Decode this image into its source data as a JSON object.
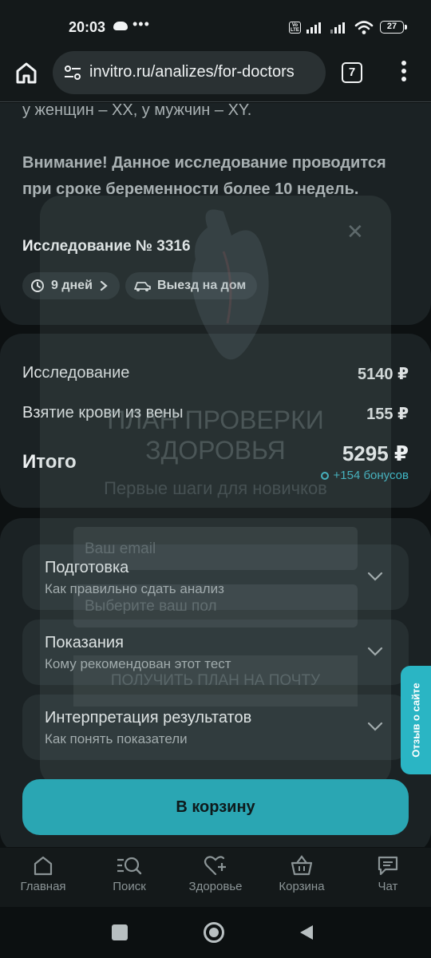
{
  "status_bar": {
    "time": "20:03",
    "battery": "27",
    "volte": "Vo LTE"
  },
  "browser": {
    "url": "invitro.ru/analizes/for-doctors",
    "tab_count": "7"
  },
  "article": {
    "karyotype_line": "у женщин – XX, у мужчин – XY.",
    "warning": "Внимание! Данное исследование проводится при сроке беременности более 10 недель.",
    "study_number": "Исследование № 3316",
    "chips": {
      "duration": "9 дней",
      "home_visit": "Выезд на дом"
    }
  },
  "pricing": {
    "study_label": "Исследование",
    "study_price": "5140 ₽",
    "blood_label": "Взятие крови из вены",
    "blood_price": "155 ₽",
    "total_label": "Итого",
    "total_price": "5295 ₽",
    "bonus": "+154 бонусов"
  },
  "accordions": [
    {
      "title": "Подготовка",
      "subtitle": "Как правильно сдать анализ"
    },
    {
      "title": "Показания",
      "subtitle": "Кому рекомендован этот тест"
    },
    {
      "title": "Интерпретация результатов",
      "subtitle": "Как понять показатели"
    }
  ],
  "cart_button": "В корзину",
  "modal": {
    "title": "ПЛАН ПРОВЕРКИ ЗДОРОВЬЯ",
    "subtitle": "Первые шаги для новичков",
    "email_placeholder": "Ваш email",
    "gender_placeholder": "Выберите ваш пол",
    "submit": "ПОЛУЧИТЬ ПЛАН НА ПОЧТУ"
  },
  "feedback_tab": "Отзыв о сайте",
  "bottom_nav": [
    {
      "label": "Главная",
      "icon": "home-icon"
    },
    {
      "label": "Поиск",
      "icon": "search-icon"
    },
    {
      "label": "Здоровье",
      "icon": "heart-plus-icon"
    },
    {
      "label": "Корзина",
      "icon": "basket-icon"
    },
    {
      "label": "Чат",
      "icon": "chat-icon"
    }
  ],
  "colors": {
    "accent": "#2aa6b3",
    "bonus": "#3fb7c5",
    "card": "#1b2224",
    "background": "#0d1112"
  }
}
